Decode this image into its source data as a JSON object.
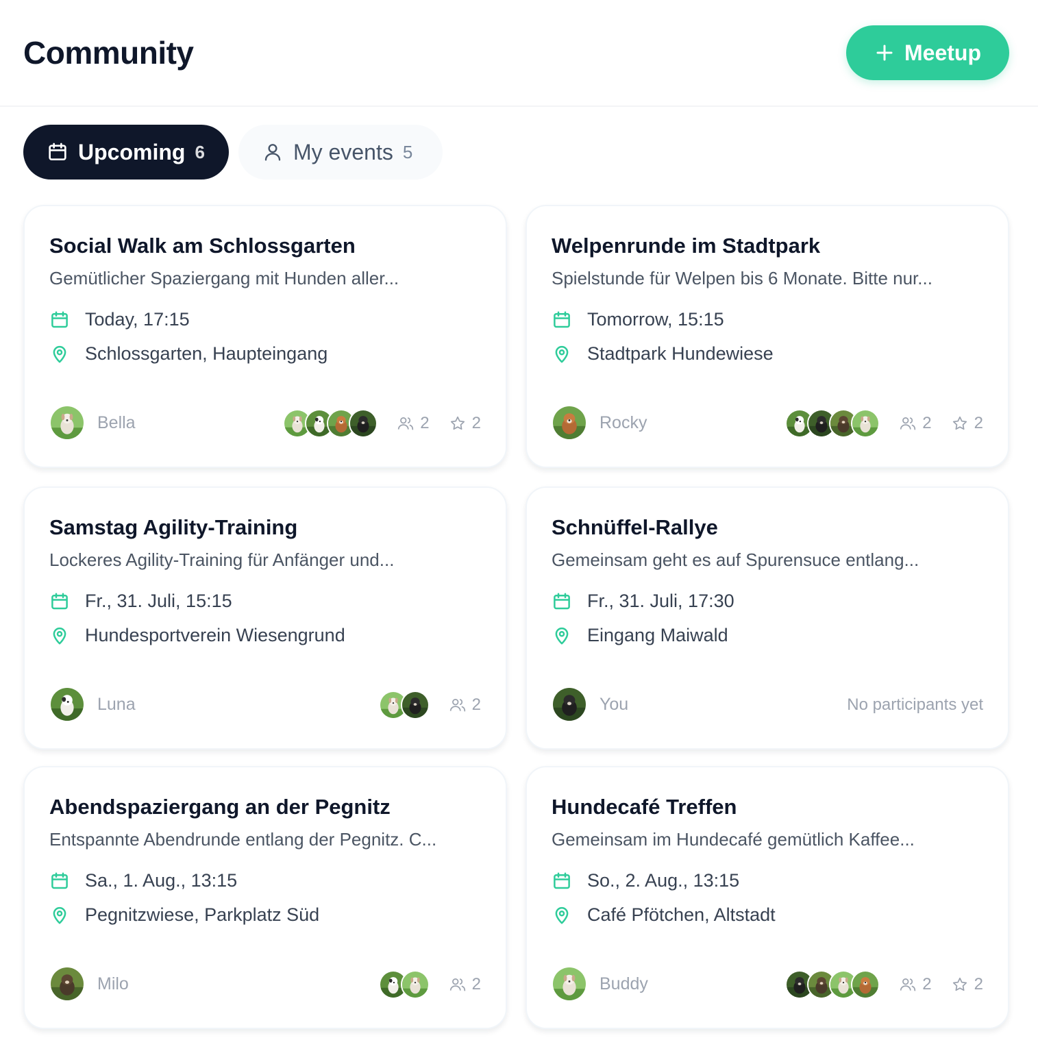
{
  "header": {
    "title": "Community",
    "meetup_label": "Meetup",
    "meetup_icon": "plus-icon"
  },
  "colors": {
    "accent": "#2ecc9a",
    "dark": "#0f172a"
  },
  "tabs": [
    {
      "label": "Upcoming",
      "count": "6",
      "icon": "calendar-icon",
      "active": true
    },
    {
      "label": "My events",
      "count": "5",
      "icon": "user-icon",
      "active": false
    }
  ],
  "events": [
    {
      "title": "Social Walk am Schlossgarten",
      "description": "Gemütlicher Spaziergang mit Hunden aller...",
      "date": "Today, 17:15",
      "location": "Schlossgarten, Haupteingang",
      "host": "Bella",
      "participants": "2",
      "likes": "2"
    },
    {
      "title": "Welpenrunde im Stadtpark",
      "description": "Spielstunde für Welpen bis 6 Monate. Bitte nur...",
      "date": "Tomorrow, 15:15",
      "location": "Stadtpark Hundewiese",
      "host": "Rocky",
      "participants": "2",
      "likes": "2"
    },
    {
      "title": "Samstag Agility-Training",
      "description": "Lockeres Agility-Training für Anfänger und...",
      "date": "Fr., 31. Juli, 15:15",
      "location": "Hundesportverein Wiesengrund",
      "host": "Luna",
      "participants": "2"
    },
    {
      "title": "Schnüffel-Rallye",
      "description": "Gemeinsam geht es auf Spurensuce entlang...",
      "date": "Fr., 31. Juli, 17:30",
      "location": "Eingang Maiwald",
      "host": "You",
      "empty_text": "No participants yet"
    },
    {
      "title": "Abendspaziergang an der Pegnitz",
      "description": "Entspannte Abendrunde entlang der Pegnitz. C...",
      "date": "Sa., 1. Aug., 13:15",
      "location": "Pegnitzwiese, Parkplatz Süd",
      "host": "Milo",
      "participants": "2"
    },
    {
      "title": "Hundecafé Treffen",
      "description": "Gemeinsam im Hundecafé gemütlich Kaffee...",
      "date": "So., 2. Aug., 13:15",
      "location": "Café Pfötchen, Altstadt",
      "host": "Buddy",
      "participants": "2",
      "likes": "2"
    }
  ]
}
